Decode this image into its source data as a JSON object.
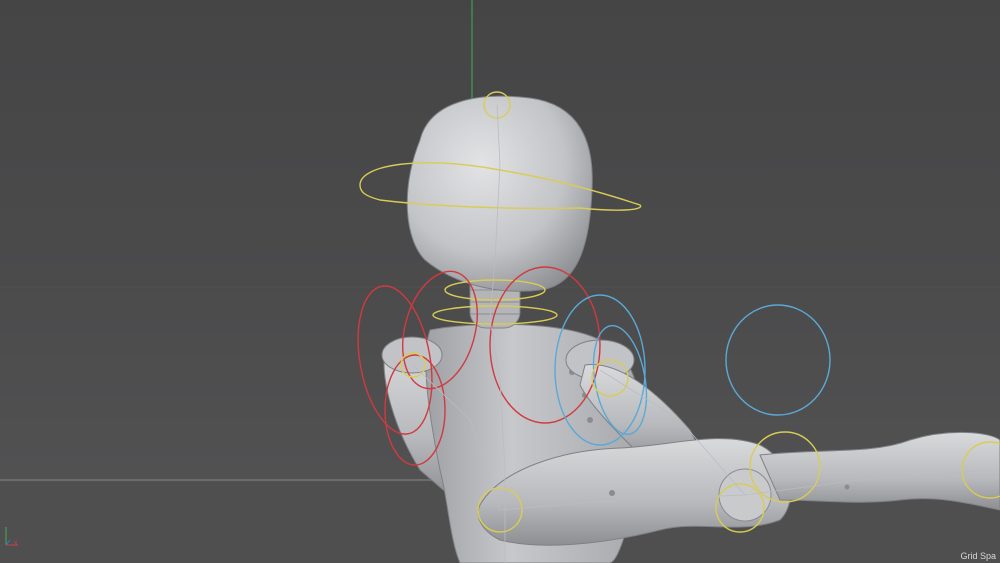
{
  "viewport": {
    "status_text": "Grid Spa",
    "axis_x_label": "x",
    "colors": {
      "background_top": "#464647",
      "background_bottom": "#525253",
      "model": "#c9cacc",
      "model_shadow": "#8e9093",
      "rig_red": "#d03a3f",
      "rig_yellow": "#d9cc55",
      "rig_blue": "#5aa9d6",
      "axis_green": "#3fae5a",
      "axis_red": "#c8423f",
      "axis_blue": "#3f6fd0"
    }
  }
}
